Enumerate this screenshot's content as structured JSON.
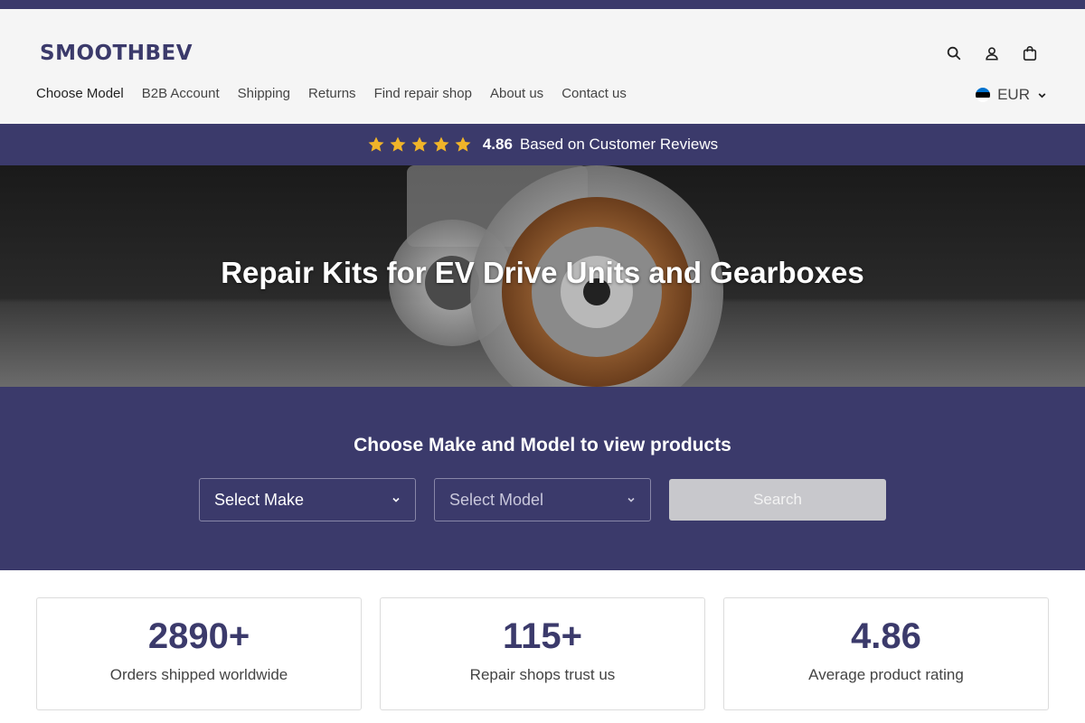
{
  "brand": {
    "logo_text": "SMOOTHBEV",
    "primary_color": "#3b3a6b"
  },
  "header": {
    "icons": [
      "search-icon",
      "user-icon",
      "cart-icon"
    ],
    "nav": [
      {
        "label": "Choose Model"
      },
      {
        "label": "B2B Account"
      },
      {
        "label": "Shipping"
      },
      {
        "label": "Returns"
      },
      {
        "label": "Find repair shop"
      },
      {
        "label": "About us"
      },
      {
        "label": "Contact us"
      }
    ],
    "currency": {
      "label": "EUR",
      "flag_icon": "estonia-flag-icon"
    }
  },
  "rating_bar": {
    "stars": 5,
    "value": "4.86",
    "text": "Based on Customer Reviews",
    "star_color": "#f0b429"
  },
  "hero": {
    "title": "Repair Kits for EV Drive Units and Gearboxes"
  },
  "picker": {
    "title": "Choose Make and Model to view products",
    "make_select": "Select Make",
    "model_select": "Select Model",
    "search_button": "Search"
  },
  "stats": [
    {
      "value": "2890+",
      "label": "Orders shipped worldwide"
    },
    {
      "value": "115+",
      "label": "Repair shops trust us"
    },
    {
      "value": "4.86",
      "label": "Average product rating"
    }
  ]
}
